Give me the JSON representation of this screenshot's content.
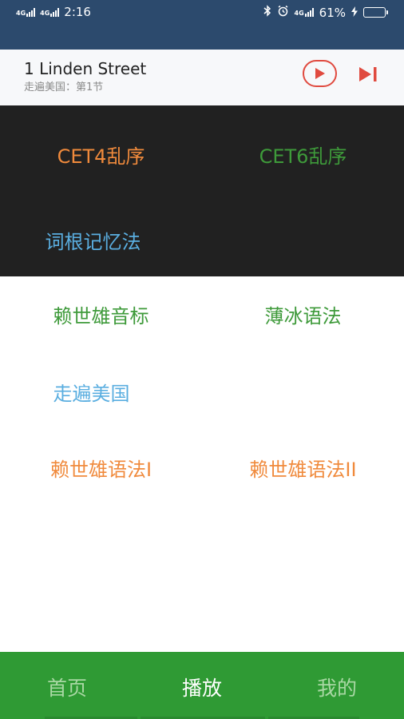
{
  "status_bar": {
    "network1": "4G",
    "network2": "4G",
    "time": "2:16",
    "network3": "4G",
    "battery": "61%",
    "battery_level": 0.61
  },
  "now_playing": {
    "title": "1 Linden Street",
    "subtitle": "走遍美国：第1节",
    "accent_color": "#e04a3f"
  },
  "dark_items": [
    {
      "label": "CET4乱序",
      "color": "#f08a3c"
    },
    {
      "label": "CET6乱序",
      "color": "#3e9a3a"
    },
    {
      "label": "词根记忆法",
      "color": "#5aaee0"
    }
  ],
  "light_items": [
    {
      "label": "赖世雄音标",
      "color": "#3e9a3a"
    },
    {
      "label": "薄冰语法",
      "color": "#3e9a3a"
    },
    {
      "label": "走遍美国",
      "color": "#5aaee0"
    },
    {
      "label": "赖世雄语法I",
      "color": "#f08a3c"
    },
    {
      "label": "赖世雄语法II",
      "color": "#f08a3c"
    }
  ],
  "tabs": [
    {
      "label": "首页",
      "active": false
    },
    {
      "label": "播放",
      "active": true
    },
    {
      "label": "我的",
      "active": false
    }
  ],
  "colors": {
    "status_bar_bg": "#2c4a6d",
    "dark_section_bg": "#212121",
    "tab_bar_bg": "#2f9a34",
    "tab_active": "#ffffff",
    "tab_inactive": "#a9d8a4"
  }
}
